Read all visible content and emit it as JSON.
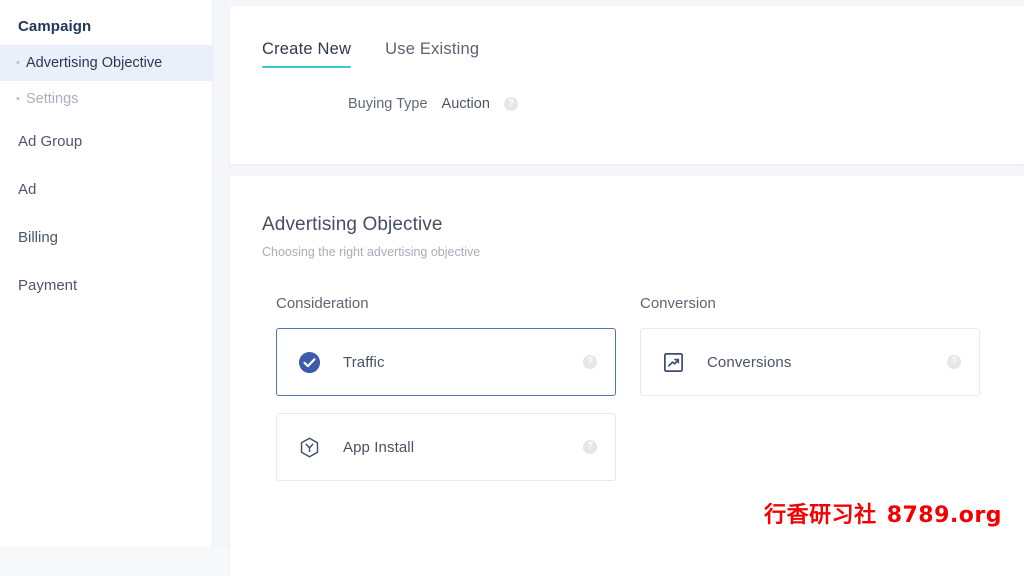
{
  "sidebar": {
    "title": "Campaign",
    "items": [
      {
        "label": "Advertising Objective",
        "bullet": "•",
        "state": "active",
        "level": "sub"
      },
      {
        "label": "Settings",
        "bullet": "•",
        "state": "muted",
        "level": "sub"
      },
      {
        "label": "Ad Group",
        "state": "normal",
        "level": "top"
      },
      {
        "label": "Ad",
        "state": "normal",
        "level": "top"
      },
      {
        "label": "Billing",
        "state": "normal",
        "level": "top"
      },
      {
        "label": "Payment",
        "state": "normal",
        "level": "top"
      }
    ]
  },
  "tabs": [
    {
      "label": "Create New",
      "active": true
    },
    {
      "label": "Use Existing",
      "active": false
    }
  ],
  "buying_type": {
    "label": "Buying Type",
    "value": "Auction",
    "help_icon": "question-mark-icon",
    "help_glyph": "?"
  },
  "objective": {
    "title": "Advertising Objective",
    "subtitle": "Choosing the right advertising objective",
    "columns": [
      {
        "heading": "Consideration",
        "cards": [
          {
            "label": "Traffic",
            "icon": "check-circle-icon",
            "selected": true,
            "help_glyph": "?"
          },
          {
            "label": "App Install",
            "icon": "hexagon-app-icon",
            "selected": false,
            "help_glyph": "?"
          }
        ]
      },
      {
        "heading": "Conversion",
        "cards": [
          {
            "label": "Conversions",
            "icon": "trending-up-square-icon",
            "selected": false,
            "help_glyph": "?"
          }
        ]
      }
    ]
  },
  "watermark": {
    "text_cn": "行香研习社",
    "text_url": "8789.org",
    "color": "#f40000"
  },
  "colors": {
    "accent_tab": "#33c9da",
    "selected_border": "#5573ad",
    "check_fill": "#3b5ca8",
    "active_nav_bg": "#eaf0fa",
    "page_bg": "#f5f6f9"
  }
}
